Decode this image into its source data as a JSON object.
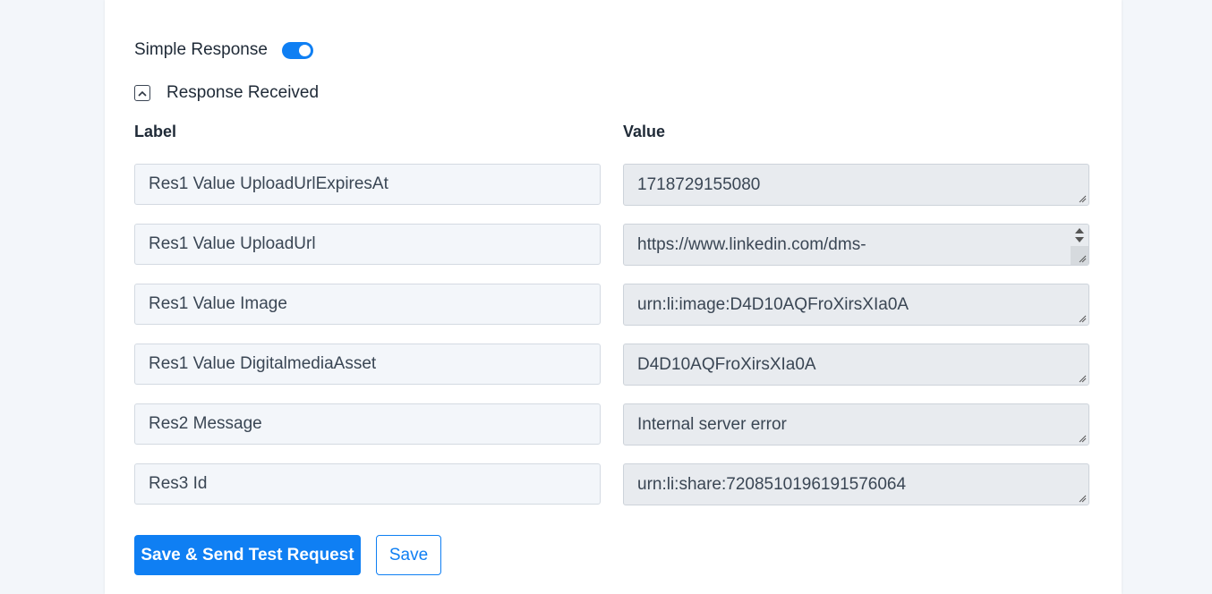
{
  "simple_response": {
    "label": "Simple Response",
    "enabled": true,
    "accent_color": "#0f7ff3"
  },
  "response_section": {
    "toggle_icon": "chevron-up-icon",
    "title": "Response Received"
  },
  "columns": {
    "label_header": "Label",
    "value_header": "Value"
  },
  "rows": [
    {
      "label": "Res1 Value UploadUrlExpiresAt",
      "value": "1718729155080"
    },
    {
      "label": "Res1 Value UploadUrl",
      "value": "https://www.linkedin.com/dms-"
    },
    {
      "label": "Res1 Value Image",
      "value": "urn:li:image:D4D10AQFroXirsXIa0A"
    },
    {
      "label": "Res1 Value DigitalmediaAsset",
      "value": "D4D10AQFroXirsXIa0A"
    },
    {
      "label": "Res2 Message",
      "value": "Internal server error"
    },
    {
      "label": "Res3 Id",
      "value": "urn:li:share:7208510196191576064"
    }
  ],
  "actions": {
    "save_send_label": "Save & Send Test Request",
    "save_label": "Save"
  }
}
